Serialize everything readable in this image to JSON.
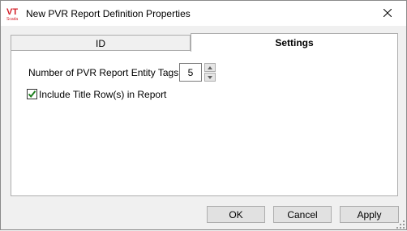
{
  "window": {
    "title": "New PVR Report Definition Properties",
    "icon": "vtscada-app-icon",
    "close_icon": "close-icon"
  },
  "tabs": [
    {
      "label": "ID",
      "active": false
    },
    {
      "label": "Settings",
      "active": true
    }
  ],
  "settings": {
    "tags_label": "Number of PVR Report Entity Tags",
    "tags_value": "5",
    "include_title_label": "Include Title Row(s) in Report",
    "include_title_checked": true
  },
  "buttons": {
    "ok": "OK",
    "cancel": "Cancel",
    "apply": "Apply"
  },
  "colors": {
    "logo_red": "#d3202a",
    "check_green": "#1e7e1e"
  }
}
